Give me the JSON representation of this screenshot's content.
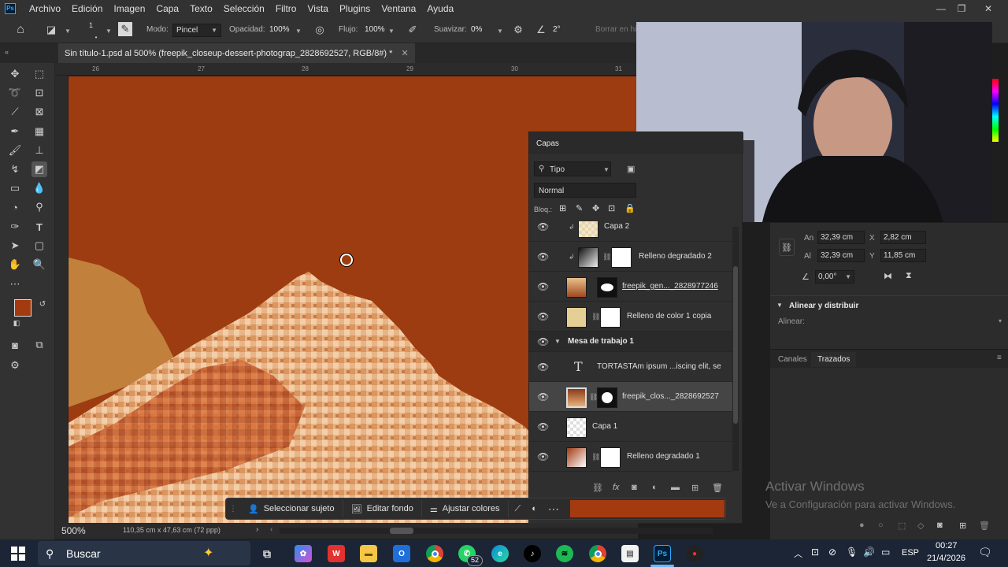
{
  "menubar": {
    "logo": "Ps",
    "items": [
      "Archivo",
      "Edición",
      "Imagen",
      "Capa",
      "Texto",
      "Selección",
      "Filtro",
      "Vista",
      "Plugins",
      "Ventana",
      "Ayuda"
    ]
  },
  "options": {
    "mode_label": "Modo:",
    "mode_value": "Pincel",
    "opacity_label": "Opacidad:",
    "opacity_value": "100%",
    "flow_label": "Flujo:",
    "flow_value": "100%",
    "smooth_label": "Suavizar:",
    "smooth_value": "0%",
    "angle_value": "2°",
    "erase_history": "Borrar en hi",
    "brush_size": "1"
  },
  "document": {
    "tab_title": "Sin título-1.psd al 500% (freepik_closeup-dessert-photograp_2828692527, RGB/8#) *",
    "zoom": "500%",
    "size_info": "110,35 cm x 47,63 cm (72 ppp)"
  },
  "ruler": {
    "marks": [
      "26",
      "27",
      "28",
      "29",
      "30",
      "31"
    ]
  },
  "colors": {
    "foreground": "#a33a10",
    "background": "#ffffff",
    "canvas": "#9c3c10"
  },
  "layers_panel": {
    "title": "Capas",
    "filter_label": "Tipo",
    "blend_mode": "Normal",
    "lock_label": "Bloq.:",
    "layers": [
      {
        "name": "Capa 2",
        "clipped": true
      },
      {
        "name": "Relleno degradado 2",
        "clipped": true
      },
      {
        "name": "freepik_gen..._2828977246"
      },
      {
        "name": "Relleno de color 1 copia"
      },
      {
        "name": "Mesa de trabajo 1",
        "group": true
      },
      {
        "name": "TORTASTAm ipsum ...iscing elit, se",
        "type": "text"
      },
      {
        "name": "freepik_clos..._2828692527",
        "selected": true
      },
      {
        "name": "Capa 1"
      },
      {
        "name": "Relleno degradado 1"
      }
    ]
  },
  "properties": {
    "an_label": "An",
    "an_value": "32,39 cm",
    "al_label": "Al",
    "al_value": "32,39 cm",
    "x_label": "X",
    "x_value": "2,82 cm",
    "y_label": "Y",
    "y_value": "11,85 cm",
    "rotation_value": "0,00°",
    "align_section": "Alinear y distribuir",
    "align_label": "Alinear:"
  },
  "bottom_tabs": [
    "Canales",
    "Trazados"
  ],
  "contextual_bar": {
    "select_subject": "Seleccionar sujeto",
    "edit_background": "Editar fondo",
    "adjust_colors": "Ajustar colores"
  },
  "activation": {
    "title": "Activar Windows",
    "subtitle": "Ve a Configuración para activar Windows."
  },
  "taskbar": {
    "search_placeholder": "Buscar",
    "whatsapp_badge": "52",
    "language": "ESP",
    "time": "00:27",
    "date": "21/4/2026"
  }
}
